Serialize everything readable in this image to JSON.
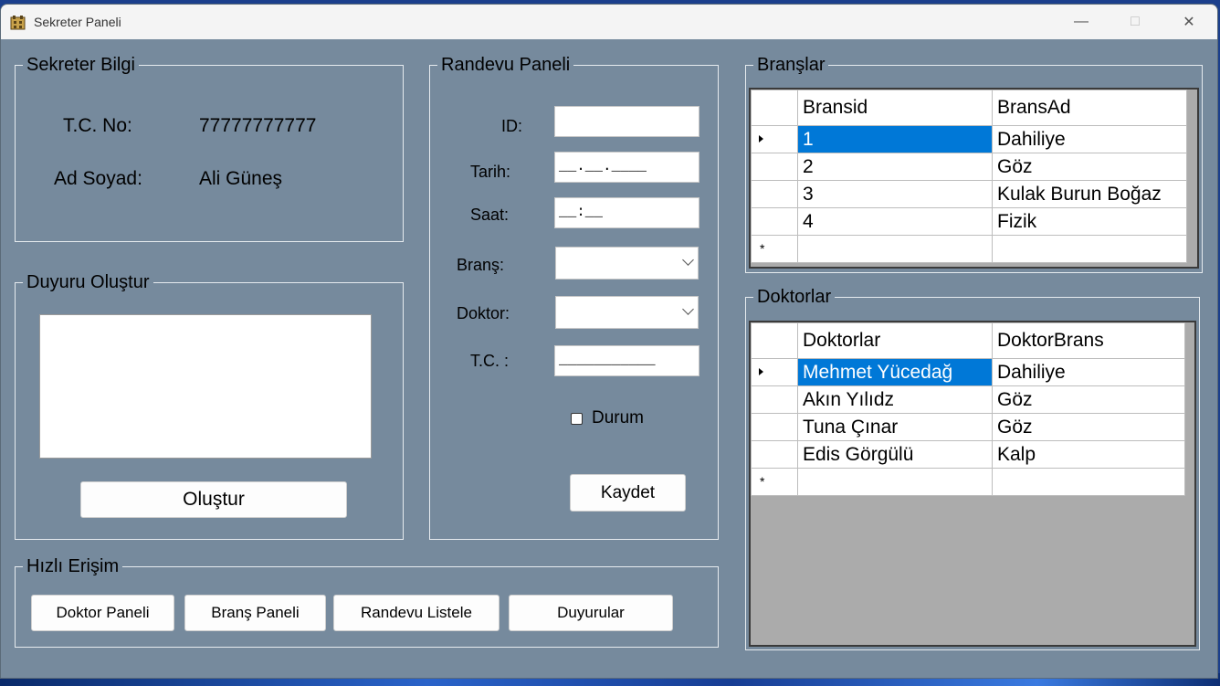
{
  "window": {
    "title": "Sekreter Paneli"
  },
  "sekreter_bilgi": {
    "title": "Sekreter Bilgi",
    "tc_label": "T.C. No:",
    "tc_value": "77777777777",
    "name_label": "Ad Soyad:",
    "name_value": "Ali Güneş"
  },
  "duyuru": {
    "title": "Duyuru Oluştur",
    "text": "",
    "button": "Oluştur"
  },
  "randevu": {
    "title": "Randevu Paneli",
    "id_label": "ID:",
    "id_value": "",
    "tarih_label": "Tarih:",
    "tarih_value": "__.__.____",
    "saat_label": "Saat:",
    "saat_value": "__:__",
    "brans_label": "Branş:",
    "brans_value": "",
    "doktor_label": "Doktor:",
    "doktor_value": "",
    "tc_label": "T.C. :",
    "tc_value": "___________",
    "durum_label": "Durum",
    "durum_checked": false,
    "save_button": "Kaydet"
  },
  "hizli": {
    "title": "Hızlı Erişim",
    "buttons": [
      "Doktor Paneli",
      "Branş Paneli",
      "Randevu Listele",
      "Duyurular"
    ]
  },
  "branslar": {
    "title": "Branşlar",
    "columns": [
      "Bransid",
      "BransAd"
    ],
    "rows": [
      [
        "1",
        "Dahiliye"
      ],
      [
        "2",
        "Göz"
      ],
      [
        "3",
        "Kulak Burun Boğaz"
      ],
      [
        "4",
        "Fizik"
      ]
    ],
    "new_row_marker": "*"
  },
  "doktorlar": {
    "title": "Doktorlar",
    "columns": [
      "Doktorlar",
      "DoktorBrans"
    ],
    "rows": [
      [
        "Mehmet Yücedağ",
        "Dahiliye"
      ],
      [
        "Akın  Yılıdz",
        "Göz"
      ],
      [
        "Tuna  Çınar",
        "Göz"
      ],
      [
        "Edis Görgülü",
        "Kalp"
      ]
    ],
    "new_row_marker": "*"
  },
  "colors": {
    "form_bg": "#768a9d",
    "selection": "#0078d7"
  }
}
